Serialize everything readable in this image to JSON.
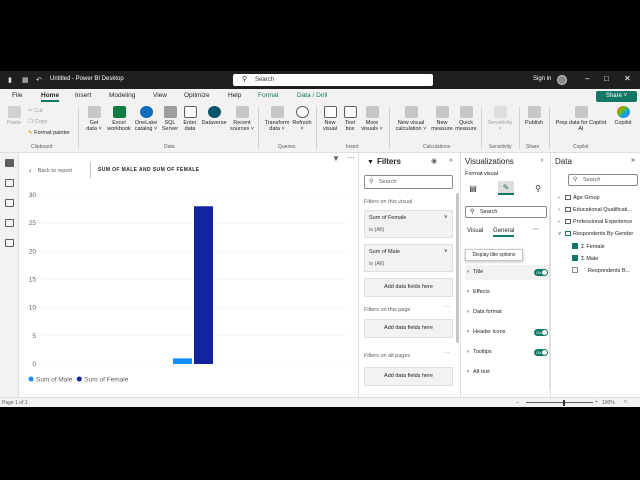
{
  "window": {
    "title": "Untitled - Power BI Desktop",
    "search_placeholder": "Search",
    "sign_in": "Sign in"
  },
  "menu": {
    "items": [
      "File",
      "Home",
      "Insert",
      "Modeling",
      "View",
      "Optimize",
      "Help",
      "Format",
      "Data / Drill"
    ],
    "active": "Home",
    "share": "Share"
  },
  "ribbon": {
    "clipboard": {
      "paste": "Paste",
      "cut": "Cut",
      "copy": "Copy",
      "format_painter": "Format painter",
      "group": "Clipboard"
    },
    "data": {
      "get_data": [
        "Get",
        "data ˅"
      ],
      "excel": [
        "Excel",
        "workbook"
      ],
      "onelake": [
        "OneLake",
        "catalog ˅"
      ],
      "sql": [
        "SQL",
        "Server"
      ],
      "enter": [
        "Enter",
        "data"
      ],
      "dataverse": [
        "Dataverse"
      ],
      "recent": [
        "Recent",
        "sources ˅"
      ],
      "group": "Data"
    },
    "queries": {
      "transform": [
        "Transform",
        "data ˅"
      ],
      "refresh": [
        "Refresh",
        "˅"
      ],
      "group": "Queries"
    },
    "insert": {
      "new_visual": [
        "New",
        "visual"
      ],
      "text_box": [
        "Text",
        "box"
      ],
      "more_visuals": [
        "More",
        "visuals ˅"
      ],
      "group": "Insert"
    },
    "calculations": {
      "new_visual_calc": [
        "New visual",
        "calculation ˅"
      ],
      "new_measure": [
        "New",
        "measure"
      ],
      "quick_measure": [
        "Quick",
        "measure"
      ],
      "group": "Calculations"
    },
    "sensitivity": {
      "label": [
        "Sensitivity",
        "˅"
      ],
      "group": "Sensitivity"
    },
    "share": {
      "publish": [
        "Publish"
      ],
      "group": "Share"
    },
    "copilot": {
      "prep": [
        "Prep data for Copilot",
        "AI"
      ],
      "copilot": [
        "Copilot"
      ],
      "group": "Copilot"
    }
  },
  "canvas": {
    "back": "Back to report",
    "title": "SUM OF MALE AND SUM OF FEMALE",
    "legend": [
      "Sum of Male",
      "Sum of Female"
    ]
  },
  "chart_data": {
    "type": "bar",
    "categories": [
      ""
    ],
    "series": [
      {
        "name": "Sum of Male",
        "values": [
          1
        ],
        "color": "#118DFF"
      },
      {
        "name": "Sum of Female",
        "values": [
          28
        ],
        "color": "#12239E"
      }
    ],
    "yticks": [
      0,
      5,
      10,
      15,
      20,
      25,
      30
    ],
    "ylim": [
      0,
      30
    ],
    "legend_position": "bottom-left"
  },
  "filters": {
    "title": "Filters",
    "search": "Search",
    "on_visual": "Filters on this visual",
    "cards": [
      {
        "title": "Sum of Female",
        "state": "is (All)"
      },
      {
        "title": "Sum of Male",
        "state": "is (All)"
      }
    ],
    "add_fields": "Add data fields here",
    "on_page": "Filters on this page",
    "on_all": "Filters on all pages"
  },
  "viz": {
    "title": "Visualizations",
    "format_visual": "Format visual",
    "search": "Search",
    "tab_visual": "Visual",
    "tab_general": "General",
    "tooltip": "Display title options",
    "toggle_on": "On",
    "sections": [
      "Title",
      "Effects",
      "Data format",
      "Header icons",
      "Tooltips",
      "Alt text"
    ]
  },
  "data_pane": {
    "title": "Data",
    "search": "Search",
    "tables": [
      "Age Group",
      "Educational Qualificati...",
      "Professional Experience",
      "Respondents By Gender"
    ],
    "fields": [
      "Female",
      "Male",
      "Respondents B..."
    ]
  },
  "status": {
    "page": "Page 1 of 1",
    "zoom": "100%",
    "zoom_level": 1.0
  }
}
